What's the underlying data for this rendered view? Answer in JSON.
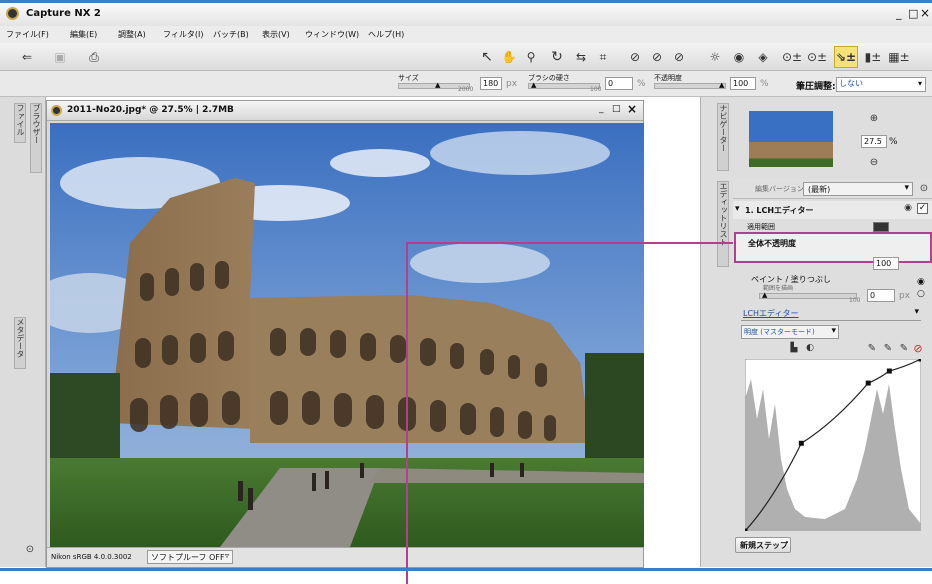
{
  "app": {
    "title": "Capture NX 2",
    "window_controls": {
      "minimize": "_",
      "maximize": "□",
      "close": "×"
    }
  },
  "menu": [
    "ファイル(F)",
    "編集(E)",
    "調整(A)",
    "フィルタ(I)",
    "バッチ(B)",
    "表示(V)",
    "ウィンドウ(W)",
    "ヘルプ(H)"
  ],
  "options": {
    "size_label": "サイズ",
    "size_value": "180",
    "size_unit": "px",
    "size_max": "2000",
    "brush_hardness_label": "ブラシの硬さ",
    "brush_hardness_value": "0",
    "brush_hardness_max": "100",
    "brush_hardness_unit": "%",
    "opacity_label": "不透明度",
    "opacity_value": "100",
    "opacity_unit": "%",
    "pressure_label": "筆圧調整:",
    "pressure_value": "しない"
  },
  "left_tabs": {
    "browser": "ブラウザー",
    "file": "ファイル",
    "metadata": "メタデータ"
  },
  "document": {
    "title": "2011-No20.jpg* @ 27.5% | 2.7MB",
    "profile": "Nikon sRGB 4.0.0.3002",
    "softproof": "ソフトプルーフ OFF"
  },
  "navigator": {
    "tab": "ナビゲーター",
    "zoom_value": "27.5",
    "zoom_unit": "%"
  },
  "edit_list": {
    "tab": "エディットリスト",
    "version_label": "編集バージョン",
    "version_value": "(最新)",
    "step_title": "1. LCHエディター",
    "apply_range": "適用範囲",
    "overall_opacity": "全体不透明度",
    "opacity_value": "100",
    "paint_label": "ペイント / 塗りつぶし",
    "paint_sub": "範囲を描画",
    "paint_value": "0",
    "paint_max": "100",
    "paint_unit": "px",
    "tool_select": "LCHエディター",
    "channel_select": "明度 (マスターモード)",
    "new_step": "新規ステップ"
  },
  "curve": {
    "points": [
      [
        0,
        0
      ],
      [
        0.32,
        0.51
      ],
      [
        0.7,
        0.86
      ],
      [
        0.82,
        0.93
      ],
      [
        1,
        1
      ]
    ]
  },
  "colors": {
    "accent": "#3c7fc4",
    "callout": "#b0418f",
    "panel": "#e6e6e6"
  }
}
